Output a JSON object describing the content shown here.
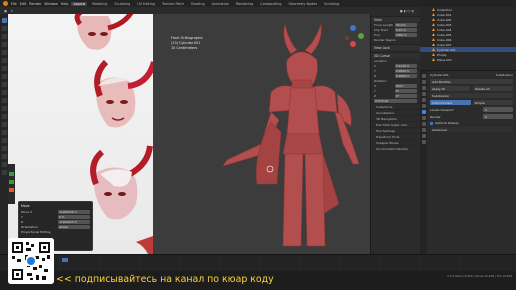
{
  "menu": [
    "File",
    "Edit",
    "Render",
    "Window",
    "Help"
  ],
  "workspaces": [
    "Layout",
    "Modeling",
    "Sculpting",
    "UV Editing",
    "Texture Paint",
    "Shading",
    "Animation",
    "Rendering",
    "Compositing",
    "Geometry Nodes",
    "Scripting"
  ],
  "active_workspace": "Layout",
  "viewport_info": {
    "line1": "Front Orthographic",
    "line2": "(13) Cylinder.001",
    "line3": "10 Centimeters"
  },
  "npanel": {
    "view_label": "View",
    "focal_label": "Focal Length",
    "focal_value": "50 mm",
    "clip_start_label": "Clip Start",
    "clip_start_value": "0.01 m",
    "clip_end_label": "End",
    "clip_end_value": "1000 m",
    "render_region": "Render Region",
    "view_lock": "View Lock",
    "cursor_label": "3D Cursor",
    "location_label": "Location",
    "x_value": "0.1218 m",
    "y_value": "0.0000 m",
    "z_value": "0.0000 m",
    "rotation_label": "Rotation",
    "rx": "90.0°",
    "ry": "0°",
    "rz": "0°",
    "xyz_euler": "XYZ Euler",
    "sections": [
      "Collections",
      "Annotations",
      "3D Navigation",
      "Hair Dots Super Add",
      "Tool Settings",
      "Transform Tools",
      "Snapper Boxes",
      "UV Animation Bundle"
    ]
  },
  "outliner": {
    "items": [
      "Collection",
      "Cube.001",
      "Cube.002",
      "Cube.003",
      "Cube.004",
      "Cube.005",
      "Cube.006",
      "Cube.007",
      "Cylinder.001",
      "Empty",
      "Plane.001"
    ],
    "selected": "Cylinder.001"
  },
  "properties": {
    "object_name": "Cylinder.001",
    "modifier_name": "Subdivision",
    "add_modifier": "Add Modifier",
    "apply_all": "Apply All",
    "delete_all": "Delete All",
    "subdivision": "Subdivision",
    "catmull": "Catmull-Clark",
    "simple": "Simple",
    "levels_viewport_label": "Levels Viewport",
    "levels_viewport": "2",
    "render_label": "Render",
    "render": "2",
    "optimal_display": "Optimal Display",
    "advanced": "Advanced"
  },
  "dialog": {
    "title": "Move",
    "move_x_label": "Move X",
    "move_x": "-0.002229 m",
    "y_label": "Y",
    "y_value": "0 m",
    "z_label": "Z",
    "z_value": "-0.002223 m",
    "orientation_label": "Orientation",
    "orientation": "Global",
    "proportional": "Proportional Editing"
  },
  "status_bar": "3.1.0 Verts 12,556 | Faces 10,248 | Tris 20,458",
  "caption": "<< подписывайтесь на канал по кюар коду"
}
